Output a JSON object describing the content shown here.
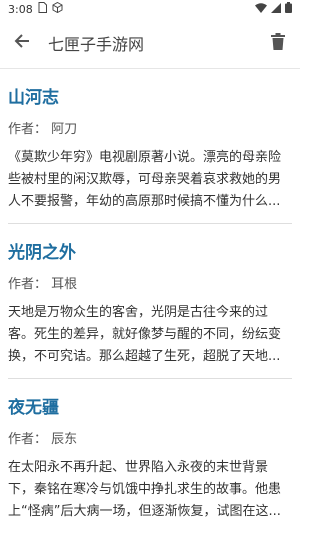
{
  "status": {
    "time": "3:08"
  },
  "header": {
    "title": "七匣子手游网"
  },
  "books": [
    {
      "title": "山河志",
      "author": "作者：  阿刀",
      "desc": "《莫欺少年穷》电视剧原著小说。漂亮的母亲险些被村里的闲汉欺辱，可母亲哭着哀求救她的男人不要报警，年幼的高原那时候搞不懂为什么..."
    },
    {
      "title": "光阴之外",
      "author": "作者：  耳根",
      "desc": "天地是万物众生的客舍，光阴是古往今来的过客。死生的差异，就好像梦与醒的不同，纷纭变换，不可究诘。那么超越了生死，超脱了天地..."
    },
    {
      "title": "夜无疆",
      "author": "作者：  辰东",
      "desc": "在太阳永不再升起、世界陷入永夜的末世背景下，秦铭在寒冷与饥饿中挣扎求生的故事。他患上“怪病”后大病一场，但逐渐恢复，试图在这..."
    }
  ],
  "icons": [
    "sim-icon",
    "cube-icon",
    "wifi-icon",
    "signal-icon",
    "battery-icon",
    "back-arrow-icon",
    "trash-icon"
  ]
}
